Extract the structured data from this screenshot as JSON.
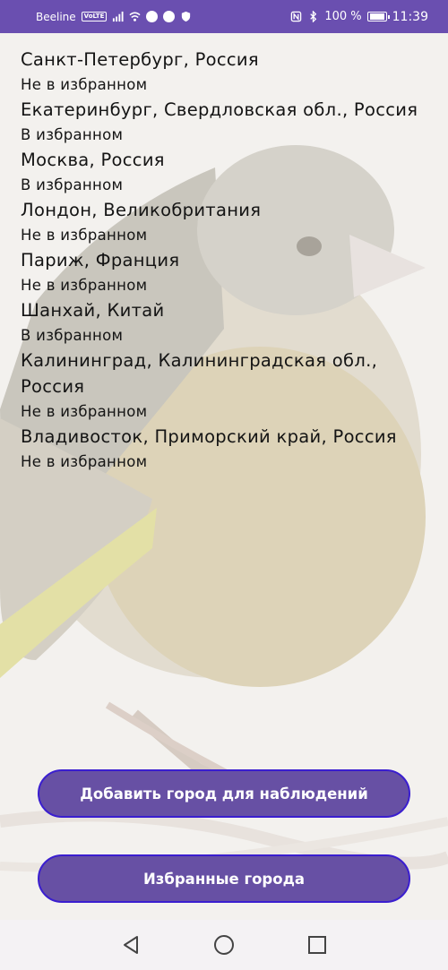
{
  "status_bar": {
    "carrier": "Beeline",
    "volte": "VoLTE",
    "battery": "100 %",
    "time": "11:39",
    "icons": [
      "signal-icon",
      "wifi-icon",
      "app-icon",
      "telegram-icon",
      "shield-icon",
      "nfc-icon",
      "bluetooth-icon",
      "battery-icon"
    ]
  },
  "cities": [
    {
      "name": "Санкт-Петербург, Россия",
      "status": "Не в избранном"
    },
    {
      "name": "Екатеринбург, Свердловская обл., Россия",
      "status": "В избранном"
    },
    {
      "name": "Москва, Россия",
      "status": "В избранном"
    },
    {
      "name": "Лондон, Великобритания",
      "status": "Не в избранном"
    },
    {
      "name": "Париж, Франция",
      "status": "Не в избранном"
    },
    {
      "name": "Шанхай, Китай",
      "status": "В избранном"
    },
    {
      "name": "Калининград, Калининградская обл., Россия",
      "status": "Не в избранном"
    },
    {
      "name": "Владивосток, Приморский край, Россия",
      "status": "Не в избранном"
    }
  ],
  "buttons": {
    "add_city": "Добавить город для наблюдений",
    "favorites": "Избранные города"
  },
  "colors": {
    "status_bar": "#6a4fb0",
    "button_fill": "#6750a4",
    "button_border": "#3a1ecf"
  },
  "nav_icons": [
    "back-icon",
    "home-icon",
    "recents-icon"
  ]
}
